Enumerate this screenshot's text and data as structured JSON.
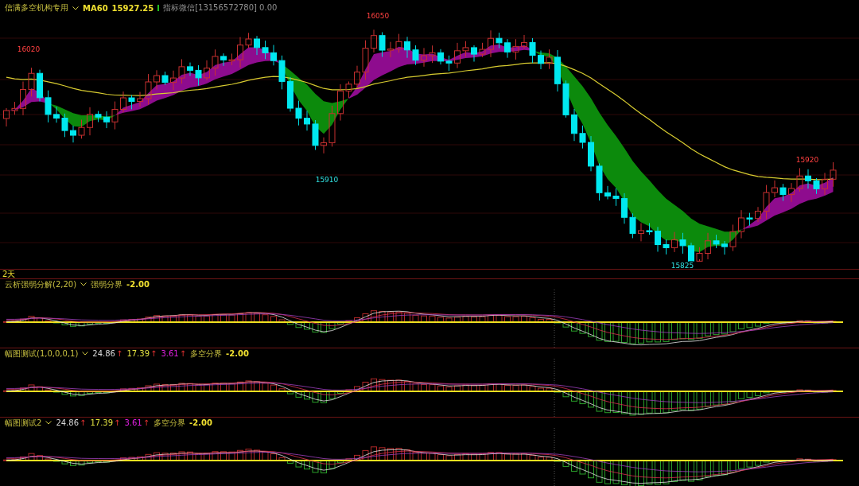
{
  "main_chart": {
    "title": "信满多空机构专用",
    "indicator_label": "MA60",
    "indicator_value": "15927.25",
    "note": "指标微信[13156572780] 0.00",
    "price_labels": [
      {
        "text": "16020",
        "kind": "high"
      },
      {
        "text": "16050",
        "kind": "high"
      },
      {
        "text": "15910",
        "kind": "low"
      },
      {
        "text": "15825",
        "kind": "low"
      },
      {
        "text": "15920",
        "kind": "high"
      }
    ]
  },
  "period_label": "2天",
  "indicator_panels": [
    {
      "title": "云析强弱分解(2,20)",
      "boundary_label": "强弱分界",
      "boundary_value": "-2.00"
    },
    {
      "title": "幅图测试(1,0,0,0,1)",
      "readings": [
        {
          "value": "24.86",
          "arrow": "↑",
          "color": "#d8d8d8"
        },
        {
          "value": "17.39",
          "arrow": "↑",
          "color": "#e0e040"
        },
        {
          "value": "3.61",
          "arrow": "↑",
          "color": "#e020e0"
        }
      ],
      "boundary_label": "多空分界",
      "boundary_value": "-2.00"
    },
    {
      "title": "幅图测试2",
      "readings": [
        {
          "value": "24.86",
          "arrow": "↑",
          "color": "#d8d8d8"
        },
        {
          "value": "17.39",
          "arrow": "↑",
          "color": "#e0e040"
        },
        {
          "value": "3.61",
          "arrow": "↑",
          "color": "#e020e0"
        }
      ],
      "boundary_label": "多空分界",
      "boundary_value": "-2.00"
    }
  ]
}
